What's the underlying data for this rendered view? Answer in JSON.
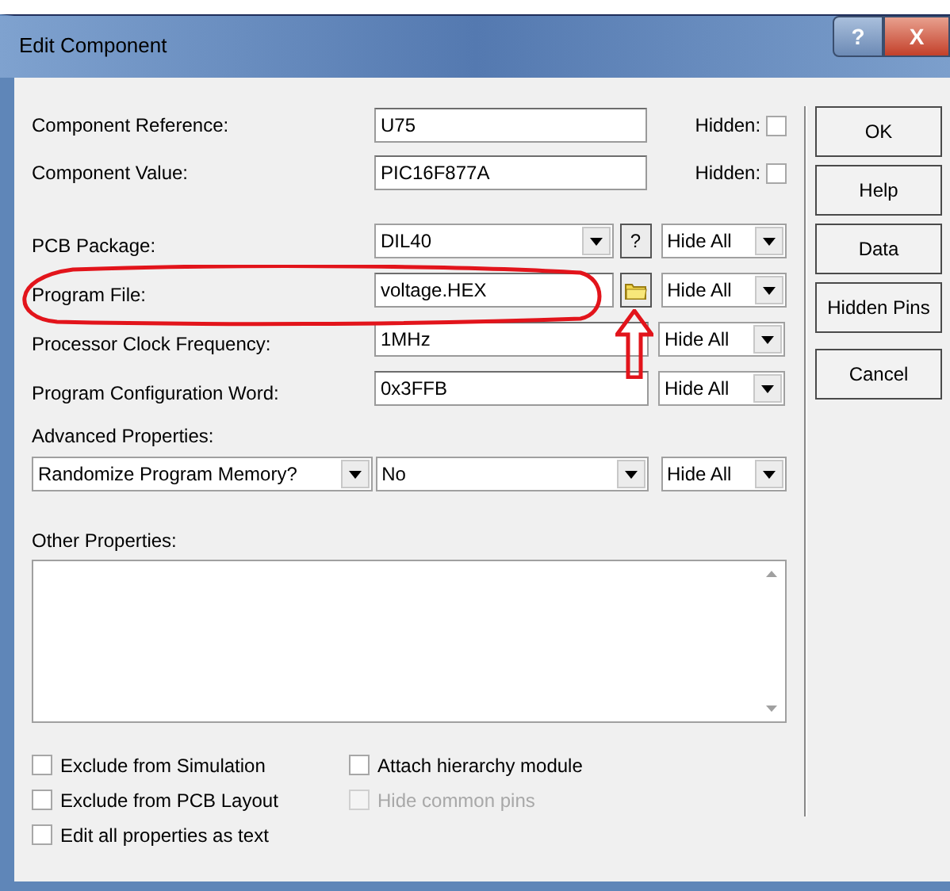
{
  "window": {
    "title": "Edit Component",
    "title_buttons": [
      {
        "label": "?",
        "kind": "help"
      },
      {
        "label": "X",
        "kind": "close"
      }
    ]
  },
  "fields": [
    {
      "label": "Component Reference:",
      "value": "U75",
      "hidden_label": "Hidden:",
      "hidden": false
    },
    {
      "label": "Component Value:",
      "value": "PIC16F877A",
      "hidden_label": "Hidden:",
      "hidden": false
    }
  ],
  "properties": [
    {
      "label": "PCB Package:",
      "value": "DIL40",
      "kind": "dropdown",
      "extra": {
        "kind": "help",
        "label": "?"
      },
      "visibility": "Hide All"
    },
    {
      "label": "Program File:",
      "value": "voltage.HEX",
      "kind": "text",
      "extra": {
        "kind": "browse"
      },
      "visibility": "Hide All"
    },
    {
      "label": "Processor Clock Frequency:",
      "value": "1MHz",
      "kind": "text",
      "visibility": "Hide All"
    },
    {
      "label": "Program Configuration Word:",
      "value": "0x3FFB",
      "kind": "text",
      "visibility": "Hide All"
    }
  ],
  "advanced": {
    "label": "Advanced Properties:",
    "property": "Randomize Program Memory?",
    "value": "No",
    "visibility": "Hide All"
  },
  "other_properties": {
    "label": "Other Properties:"
  },
  "checkbox_columns": [
    [
      {
        "label": "Exclude from Simulation",
        "checked": false,
        "disabled": false
      },
      {
        "label": "Exclude from PCB Layout",
        "checked": false,
        "disabled": false
      },
      {
        "label": "Edit all properties as text",
        "checked": false,
        "disabled": false
      }
    ],
    [
      {
        "label": "Attach hierarchy module",
        "checked": false,
        "disabled": false
      },
      {
        "label": "Hide common pins",
        "checked": false,
        "disabled": true
      }
    ]
  ],
  "buttons": [
    "OK",
    "Help",
    "Data",
    "Hidden Pins",
    "Cancel"
  ]
}
